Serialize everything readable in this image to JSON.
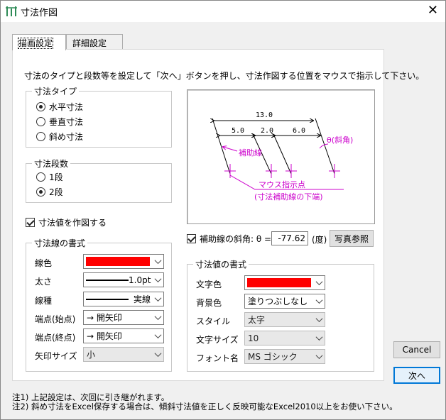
{
  "window": {
    "title": "寸法作図",
    "close_glyph": "✕"
  },
  "tabs": [
    {
      "label": "描画設定",
      "active": true
    },
    {
      "label": "詳細設定",
      "active": false
    }
  ],
  "instruction": "寸法のタイプと段数等を設定して「次へ」ボタンを押し、寸法作図する位置をマウスで指示して下さい。",
  "dim_type": {
    "label": "寸法タイプ",
    "options": [
      {
        "label": "水平寸法",
        "selected": true
      },
      {
        "label": "垂直寸法",
        "selected": false
      },
      {
        "label": "斜め寸法",
        "selected": false
      }
    ]
  },
  "dim_levels": {
    "label": "寸法段数",
    "options": [
      {
        "label": "1段",
        "selected": false
      },
      {
        "label": "2段",
        "selected": true
      }
    ]
  },
  "draw_value_checkbox": {
    "label": "寸法値を作図する",
    "checked": true
  },
  "line_format": {
    "label": "寸法線の書式",
    "color": {
      "label": "線色",
      "value_color": "#ff0000"
    },
    "width": {
      "label": "太さ",
      "value": "1.0pt"
    },
    "style": {
      "label": "線種",
      "value": "実線"
    },
    "start": {
      "label": "端点(始点)",
      "value": "→ 開矢印"
    },
    "end": {
      "label": "端点(終点)",
      "value": "→ 開矢印"
    },
    "arrow_size": {
      "label": "矢印サイズ",
      "value": "小"
    }
  },
  "preview": {
    "total": "13.0",
    "seg1": "5.0",
    "seg2": "2.0",
    "seg3": "6.0",
    "angle_label": "θ(斜角)",
    "aux_label": "補助線",
    "mouse_label_1": "マウス指示点",
    "mouse_label_2": "(寸法補助線の下端)"
  },
  "aux_angle": {
    "label": "補助線の斜角: θ =",
    "value": "-77.62",
    "unit": "(度)",
    "checked": true,
    "ref_button": "写真参照"
  },
  "value_format": {
    "label": "寸法値の書式",
    "text_color": {
      "label": "文字色",
      "value_color": "#ff0000"
    },
    "bg_color": {
      "label": "背景色",
      "value": "塗りつぶしなし"
    },
    "style": {
      "label": "スタイル",
      "value": "太字"
    },
    "size": {
      "label": "文字サイズ",
      "value": "10"
    },
    "font": {
      "label": "フォント名",
      "value": "MS ゴシック"
    }
  },
  "buttons": {
    "cancel": "Cancel",
    "next": "次へ"
  },
  "notes": [
    "注1) 上記設定は、次回に引き継がれます。",
    "注2) 斜め寸法をExcel保存する場合は、傾斜寸法値を正しく反映可能なExcel2010以上をお使い下さい。"
  ],
  "colors": {
    "accent": "#0078d7",
    "magenta": "#cc00cc"
  }
}
